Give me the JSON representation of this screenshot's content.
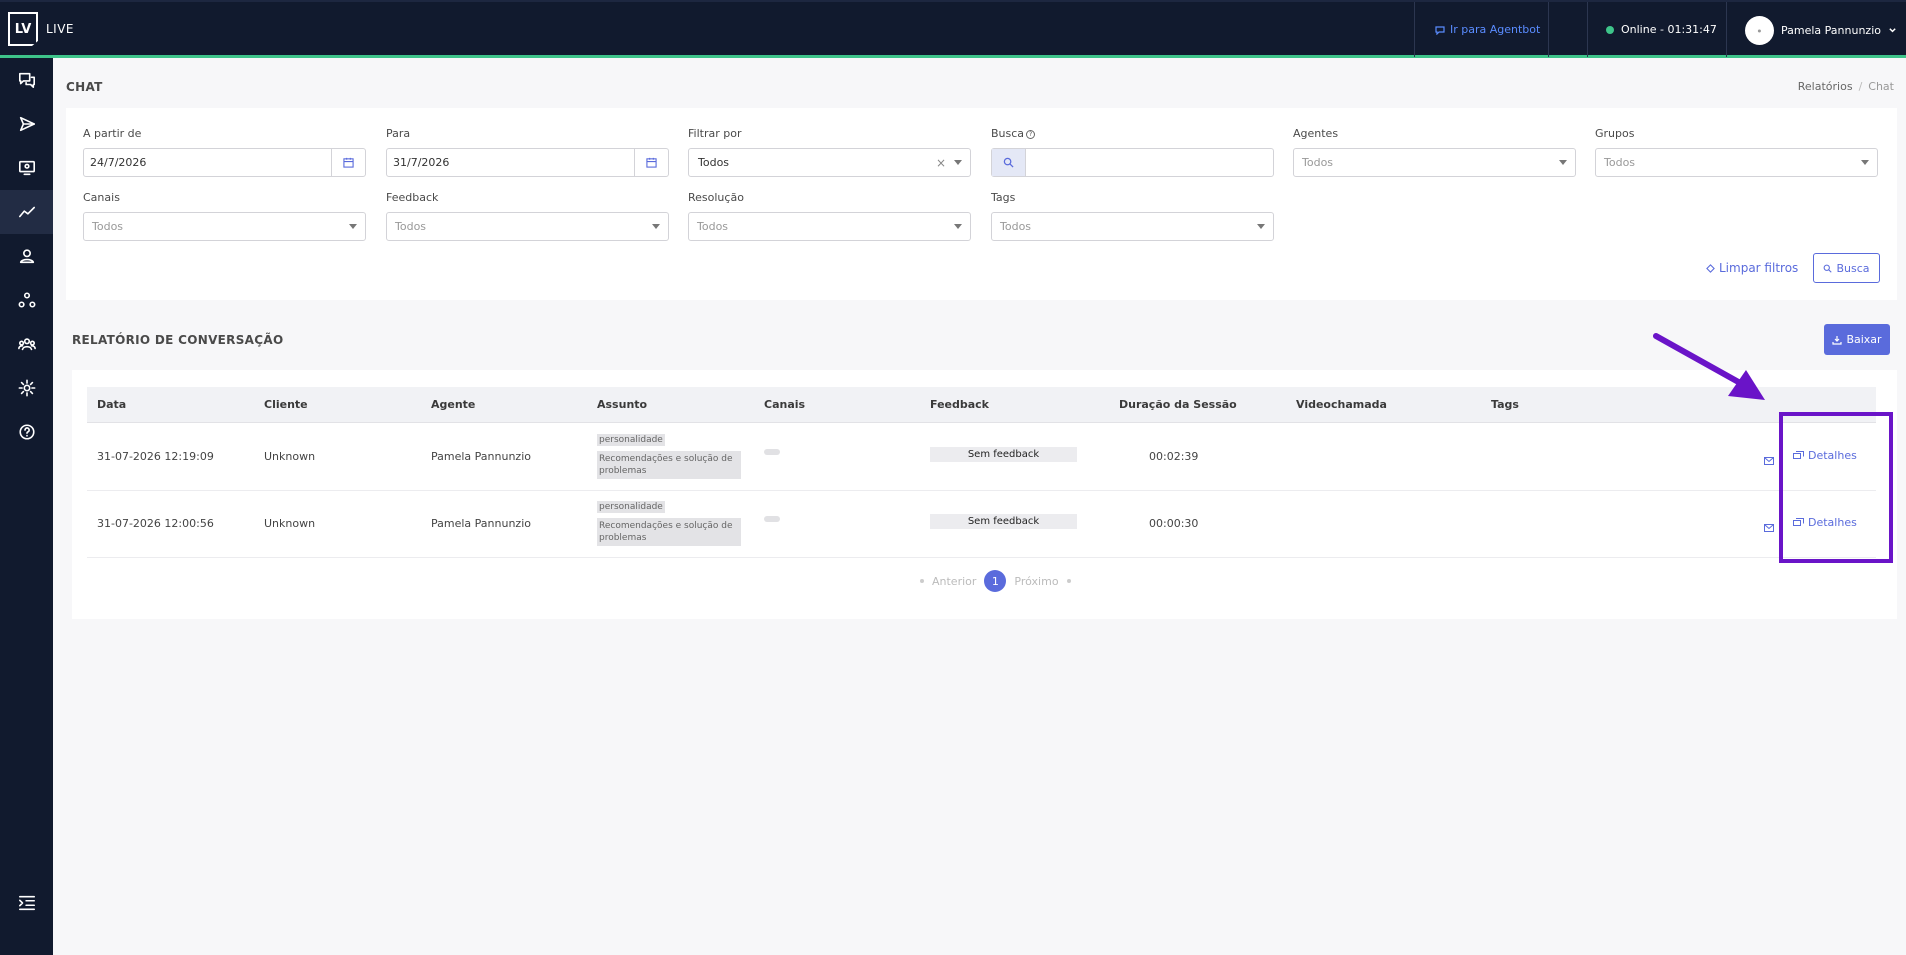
{
  "topbar": {
    "brand_logo": "LV",
    "brand_name": "LIVE",
    "agentbot_link": "Ir para Agentbot",
    "online_status": "Online - 01:31:47",
    "user_name": "Pamela Pannunzio",
    "status_color": "#3ec48a"
  },
  "sidebar": {
    "items": [
      "chat-icon",
      "send-icon",
      "monitor-icon",
      "chart-icon",
      "user-icon",
      "network-icon",
      "team-icon",
      "gear-icon",
      "help-icon"
    ],
    "active": "chart-icon",
    "bottom": "collapse-menu-icon"
  },
  "header": {
    "title": "CHAT",
    "breadcrumb": [
      "Relatórios",
      "Chat"
    ]
  },
  "filters": {
    "from_label": "A partir de",
    "from_value": "24/7/2026",
    "to_label": "Para",
    "to_value": "31/7/2026",
    "filter_by_label": "Filtrar por",
    "filter_by_value": "Todos",
    "search_label": "Busca",
    "agents_label": "Agentes",
    "agents_placeholder": "Todos",
    "groups_label": "Grupos",
    "groups_placeholder": "Todos",
    "channels_label": "Canais",
    "channels_placeholder": "Todos",
    "feedback_label": "Feedback",
    "feedback_placeholder": "Todos",
    "resolution_label": "Resolução",
    "resolution_placeholder": "Todos",
    "tags_label": "Tags",
    "tags_placeholder": "Todos",
    "clear_label": "Limpar filtros",
    "search_button": "Busca"
  },
  "report": {
    "title": "RELATÓRIO DE CONVERSAÇÃO",
    "download_button": "Baixar",
    "columns": [
      "Data",
      "Cliente",
      "Agente",
      "Assunto",
      "Canais",
      "Feedback",
      "Duração da Sessão",
      "Videochamada",
      "Tags"
    ],
    "rows": [
      {
        "date": "31-07-2026 12:19:09",
        "client": "Unknown",
        "agent": "Pamela Pannunzio",
        "subject_1": "personalidade",
        "subject_2": "Recomendações e solução de problemas",
        "feedback": "Sem feedback",
        "duration": "00:02:39",
        "details": "Detalhes"
      },
      {
        "date": "31-07-2026 12:00:56",
        "client": "Unknown",
        "agent": "Pamela Pannunzio",
        "subject_1": "personalidade",
        "subject_2": "Recomendações e solução de problemas",
        "feedback": "Sem feedback",
        "duration": "00:00:30",
        "details": "Detalhes"
      }
    ],
    "pagination": {
      "prev": "Anterior",
      "current": "1",
      "next": "Próximo"
    }
  },
  "colors": {
    "accent": "#5a6bdc",
    "nav_bg": "#111a2e",
    "annotation": "#6a14c8"
  }
}
